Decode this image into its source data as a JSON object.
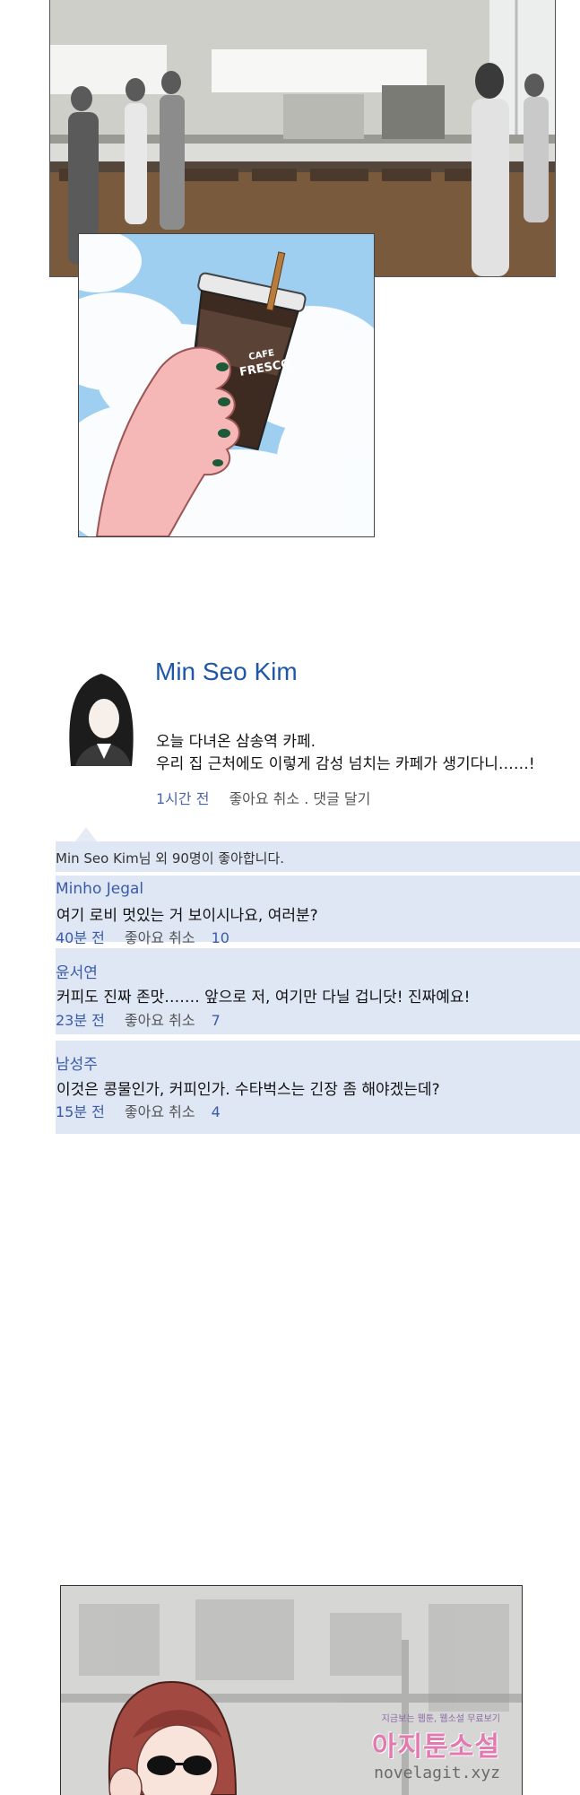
{
  "panel_cafe": {
    "cup_brand_top": "CAFE",
    "cup_brand": "FRESCO"
  },
  "post": {
    "author": "Min Seo Kim",
    "lines": [
      "오늘 다녀온 삼송역 카페.",
      "우리 집 근처에도 이렇게 감성 넘치는 카페가 생기다니……!"
    ],
    "time": "1시간 전",
    "actions": "좋아요 취소 . 댓글 달기"
  },
  "likes_summary": "Min Seo Kim님 외 90명이 좋아합니다.",
  "comments": [
    {
      "name": "Minho Jegal",
      "text": "여기 로비 멋있는 거 보이시나요, 여러분?",
      "time": "40분 전",
      "like": "좋아요 취소",
      "count": "10"
    },
    {
      "name": "윤서연",
      "text": "커피도 진짜 존맛……. 앞으로 저, 여기만 다닐 겁니닷! 진짜예요!",
      "time": "23분 전",
      "like": "좋아요 취소",
      "count": "7"
    },
    {
      "name": "남성주",
      "text": "이것은 콩물인가, 커피인가. 수타벅스는 긴장 좀 해야겠는데?",
      "time": "15분 전",
      "like": "좋아요 취소",
      "count": "4"
    }
  ],
  "watermark": {
    "small": "지금보는 웹툰, 웹소설 무료보기",
    "brand": "아지툰소설",
    "url": "novelagit.xyz"
  }
}
